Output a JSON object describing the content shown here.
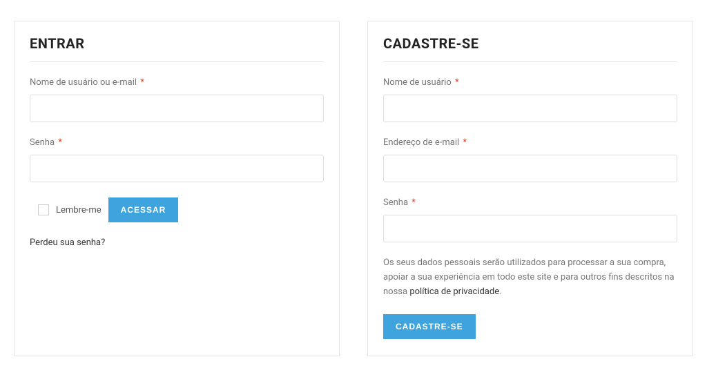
{
  "login": {
    "title": "ENTRAR",
    "username_label": "Nome de usuário ou e-mail",
    "password_label": "Senha",
    "remember_label": "Lembre-me",
    "submit_label": "ACESSAR",
    "forgot_label": "Perdeu sua senha?",
    "required": "*"
  },
  "register": {
    "title": "CADASTRE-SE",
    "username_label": "Nome de usuário",
    "email_label": "Endereço de e-mail",
    "password_label": "Senha",
    "required": "*",
    "privacy_text_before": "Os seus dados pessoais serão utilizados para processar a sua compra, apoiar a sua experiência em todo este site e para outros fins descritos na nossa ",
    "privacy_link_label": "política de privacidade",
    "privacy_text_after": ".",
    "submit_label": "CADASTRE-SE"
  }
}
